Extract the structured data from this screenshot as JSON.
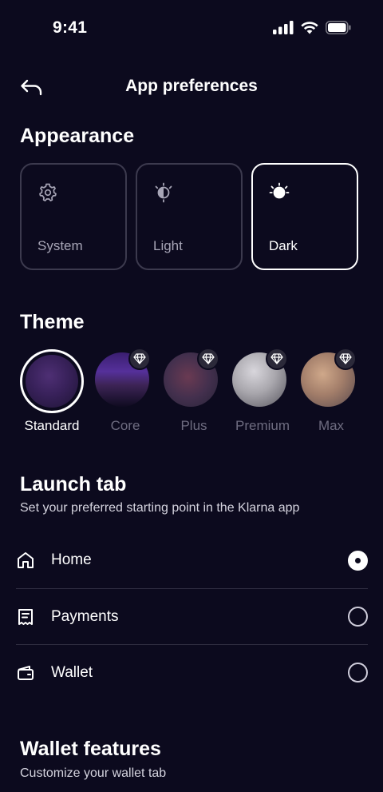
{
  "status_bar": {
    "time": "9:41"
  },
  "nav": {
    "title": "App preferences",
    "back_icon": "back-arrow-icon"
  },
  "appearance": {
    "title": "Appearance",
    "options": [
      {
        "label": "System",
        "icon": "gear-icon",
        "selected": false
      },
      {
        "label": "Light",
        "icon": "half-sun-icon",
        "selected": false
      },
      {
        "label": "Dark",
        "icon": "half-moon-icon",
        "selected": true
      }
    ]
  },
  "theme": {
    "title": "Theme",
    "options": [
      {
        "label": "Standard",
        "selected": true,
        "premium": false
      },
      {
        "label": "Core",
        "selected": false,
        "premium": true
      },
      {
        "label": "Plus",
        "selected": false,
        "premium": true
      },
      {
        "label": "Premium",
        "selected": false,
        "premium": true
      },
      {
        "label": "Max",
        "selected": false,
        "premium": true
      }
    ]
  },
  "launch_tab": {
    "title": "Launch tab",
    "subtitle": "Set your preferred starting point in the Klarna app",
    "options": [
      {
        "label": "Home",
        "icon": "house-icon",
        "selected": true
      },
      {
        "label": "Payments",
        "icon": "receipt-icon",
        "selected": false
      },
      {
        "label": "Wallet",
        "icon": "wallet-icon",
        "selected": false
      }
    ]
  },
  "wallet_features": {
    "title": "Wallet features",
    "subtitle": "Customize your wallet tab"
  },
  "colors": {
    "background": "#0c0a1e",
    "text": "#ffffff",
    "muted": "#a7a5b6",
    "border": "#3c3a4e"
  }
}
